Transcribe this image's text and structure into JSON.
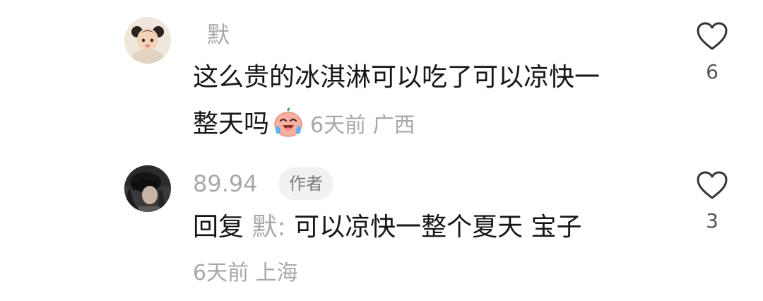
{
  "comments": [
    {
      "author": "默",
      "avatar": "avatar-girl",
      "text_line1": "这么贵的冰淇淋可以吃了可以凉快一",
      "text_line2": "整天吗",
      "emoji": "crying-laughing-emoji",
      "meta": "6天前 广西",
      "likes": "6"
    },
    {
      "author": "89.94",
      "author_badge": "作者",
      "avatar": "avatar-dark-hair",
      "reply_prefix": "回复",
      "reply_to": "默:",
      "text": "可以凉快一整个夏天 宝子",
      "meta": "6天前 上海",
      "likes": "3"
    }
  ],
  "colors": {
    "text": "#161616",
    "secondary": "#a8a8a8",
    "badge_bg": "#f1f1f1"
  }
}
